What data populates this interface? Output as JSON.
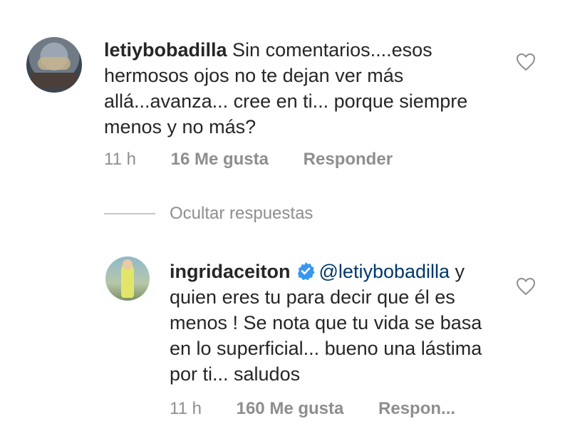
{
  "comments": [
    {
      "username": "letiybobadilla",
      "text": " Sin comentarios....esos hermosos ojos no te dejan ver más allá...avanza... cree en ti... porque siempre menos y no más?",
      "time": "11 h",
      "likes": "16 Me gusta",
      "reply": "Responder",
      "avatar_icon": "profile-photo"
    },
    {
      "username": "ingridaceiton",
      "mention": "@letiybobadilla",
      "text": "y quien eres tu para decir que él es menos ! Se nota que tu vida se basa en lo superficial... bueno una lástima por ti... saludos",
      "time": "11 h",
      "likes": "160 Me gusta",
      "reply": "Respon...",
      "verified_icon": "verified-badge-icon",
      "avatar_icon": "profile-photo"
    }
  ],
  "hide_replies": "Ocultar respuestas",
  "colors": {
    "text": "#262626",
    "secondary": "#8e8e8e",
    "mention": "#00376b",
    "verified": "#3897f0"
  }
}
